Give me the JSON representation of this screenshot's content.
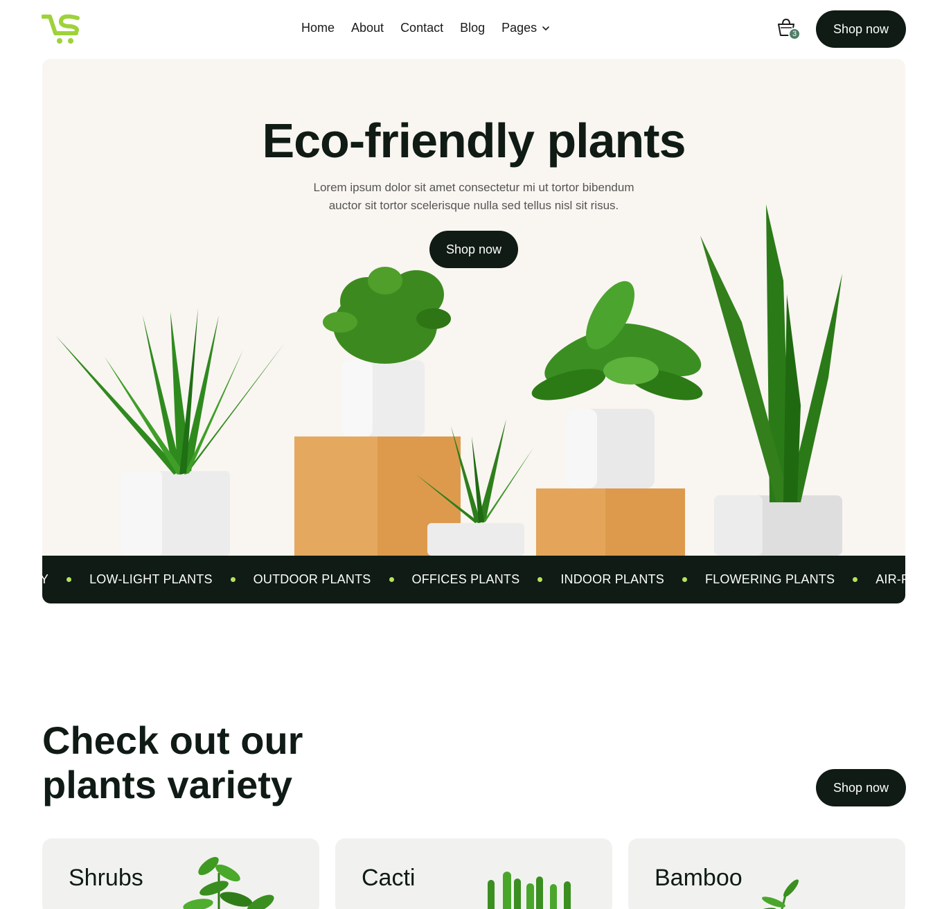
{
  "header": {
    "nav": [
      {
        "label": "Home"
      },
      {
        "label": "About"
      },
      {
        "label": "Contact"
      },
      {
        "label": "Blog"
      },
      {
        "label": "Pages",
        "has_dropdown": true
      }
    ],
    "cart_count": "3",
    "cta_label": "Shop now"
  },
  "hero": {
    "title": "Eco-friendly plants",
    "subtitle_line1": "Lorem ipsum dolor sit amet consectetur mi ut tortor bibendum",
    "subtitle_line2": "auctor sit tortor scelerisque nulla sed tellus nisl sit risus.",
    "cta_label": "Shop now"
  },
  "ticker": {
    "items": [
      "LY",
      "LOW-LIGHT PLANTS",
      "OUTDOOR PLANTS",
      "OFFICES PLANTS",
      "INDOOR PLANTS",
      "FLOWERING PLANTS",
      "AIR-PURIFY"
    ]
  },
  "variety": {
    "title_line1": "Check out our",
    "title_line2": "plants variety",
    "cta_label": "Shop now",
    "cards": [
      {
        "title": "Shrubs"
      },
      {
        "title": "Cacti"
      },
      {
        "title": "Bamboo"
      }
    ]
  },
  "colors": {
    "brand_dark": "#0f1b14",
    "accent_green": "#9ed23a",
    "hero_bg": "#f9f5f1",
    "card_bg": "#f1f2ef"
  }
}
